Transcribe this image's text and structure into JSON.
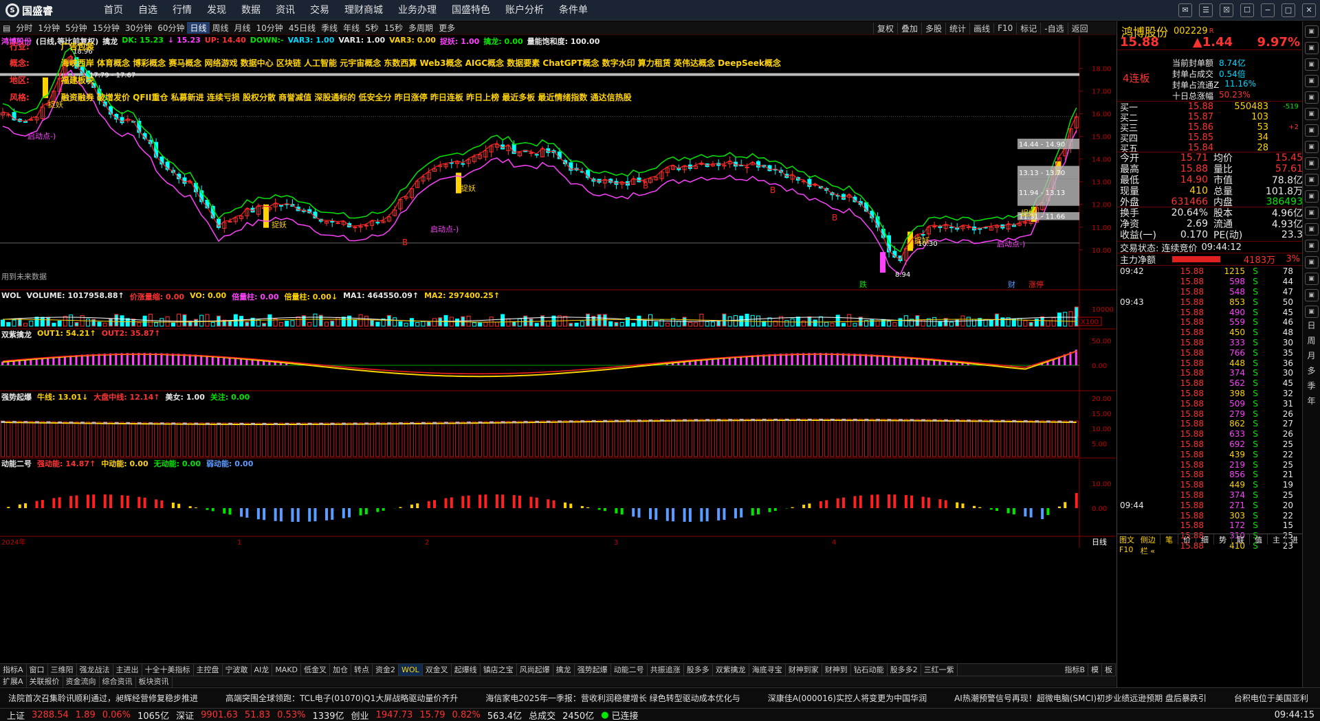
{
  "app": {
    "logo_text": "国盛睿",
    "menu": [
      "首页",
      "自选",
      "行情",
      "发现",
      "数据",
      "资讯",
      "交易",
      "理财商城",
      "业务办理",
      "国盛特色",
      "账户分析",
      "条件单"
    ],
    "win_icons": [
      "✉",
      "☰",
      "☒",
      "☐",
      "−",
      "□",
      "✕"
    ]
  },
  "periods": [
    "分时",
    "1分钟",
    "5分钟",
    "15分钟",
    "30分钟",
    "60分钟",
    "日线",
    "周线",
    "月线",
    "10分钟",
    "45日线",
    "季线",
    "年线",
    "5秒",
    "15秒",
    "多周期",
    "更多"
  ],
  "period_selected": "日线",
  "right_tools": [
    "复权",
    "叠加",
    "多股",
    "统计",
    "画线",
    "F10",
    "标记",
    "-自选",
    "返回"
  ],
  "main_info": {
    "name": "鸿博股份",
    "mode": "(日线,等比前复权)",
    "indicator": "擒龙",
    "items": [
      {
        "t": "DK: 15.23",
        "c": "green"
      },
      {
        "t": "↓ 15.23",
        "c": "mag"
      },
      {
        "t": "UP: 14.40",
        "c": "red"
      },
      {
        "t": "DOWN:-",
        "c": "green"
      },
      {
        "t": "VAR3: 1.00",
        "c": "cyan"
      },
      {
        "t": "VAR1: 1.00",
        "c": "wht"
      },
      {
        "t": "VAR3: 0.00",
        "c": "yel"
      },
      {
        "t": "捉妖: 1.00",
        "c": "mag"
      },
      {
        "t": "擒龙: 0.00",
        "c": "green"
      },
      {
        "t": "量能饱和度: 100.00",
        "c": "wht"
      }
    ]
  },
  "concepts": {
    "industry_label": "行业:",
    "industry": "广告包装",
    "concept_label": "概念:",
    "concept": "海峡西岸 体育概念 博彩概念 赛马概念 网络游戏 数据中心 区块链 人工智能 元宇宙概念 东数西算 Web3概念 AIGC概念 数据要素 ChatGPT概念 数字水印 算力租赁 英伟达概念 DeepSeek概念",
    "region_label": "地区:",
    "region": "福建板块",
    "style_label": "风格:",
    "style": "融资融券 破增发价 QFII重仓 私募新进 连续亏损 股权分散 商誉减值 深股通标的 低安全分 昨日涨停 昨日连板 昨日上榜 最近多板 最近情绪指数 通达信热股"
  },
  "main_y_labels": [
    "18.00",
    "17.00",
    "16.00",
    "15.00",
    "14.00",
    "13.00",
    "12.00",
    "11.00",
    "10.00"
  ],
  "annotations": {
    "high": "18.96",
    "high2": "17.79 - 17.67",
    "low": "8.94",
    "zy": "捉妖",
    "qd": "启动点-)",
    "bb": "B",
    "future": "用到未来数据",
    "r1": "14.44 - 14.90",
    "r2": "13.13 - 13.70",
    "r3": "11.94 - 13.13",
    "r4": "11.31 - 11.66",
    "low2": "10.30",
    "fall": "跌",
    "cai": "财",
    "zt": "涨停"
  },
  "vol_info": {
    "items": [
      {
        "t": "WOL",
        "c": "wht"
      },
      {
        "t": "VOLUME: 1017958.88↑",
        "c": "wht"
      },
      {
        "t": "价涨量缩: 0.00",
        "c": "red"
      },
      {
        "t": "VO: 0.00",
        "c": "yel"
      },
      {
        "t": "倍量柱: 0.00",
        "c": "mag"
      },
      {
        "t": "倍量柱: 0.00↓",
        "c": "yel"
      },
      {
        "t": "MA1: 464550.09↑",
        "c": "wht"
      },
      {
        "t": "MA2: 297400.25↑",
        "c": "yel"
      }
    ],
    "y": [
      "10000"
    ],
    "unit": "X100"
  },
  "sub1_info": {
    "items": [
      {
        "t": "双紫擒龙",
        "c": "wht"
      },
      {
        "t": "OUT1: 54.21↑",
        "c": "yel"
      },
      {
        "t": "OUT2: 35.87↑",
        "c": "red"
      }
    ],
    "y": [
      "50.00",
      "0.00"
    ]
  },
  "sub2_info": {
    "items": [
      {
        "t": "强势起爆",
        "c": "wht"
      },
      {
        "t": "牛线: 13.01↓",
        "c": "yel"
      },
      {
        "t": "大盘中线: 12.14↑",
        "c": "red"
      },
      {
        "t": "美女: 1.00",
        "c": "wht"
      },
      {
        "t": "关注: 0.00",
        "c": "green"
      }
    ],
    "y": [
      "20.00",
      "15.00",
      "10.00",
      "5.00"
    ]
  },
  "sub3_info": {
    "items": [
      {
        "t": "动能二号",
        "c": "wht"
      },
      {
        "t": "强动能: 14.87↑",
        "c": "red"
      },
      {
        "t": "中动能: 0.00",
        "c": "yel"
      },
      {
        "t": "无动能: 0.00",
        "c": "green"
      },
      {
        "t": "弱动能: 0.00",
        "c": "blu"
      }
    ],
    "y": [
      "10.00",
      "0.00"
    ]
  },
  "x_axis": {
    "labels": [
      "2024年",
      "1",
      "2",
      "3",
      "4"
    ],
    "corner": "日线"
  },
  "tabs": [
    "指标A",
    "窗口",
    "三维阳",
    "强龙战法",
    "主进出",
    "十全十美指标",
    "主控盘",
    "宁波敢",
    "AI龙",
    "MAKD",
    "低金叉",
    "加仓",
    "转点",
    "资金2",
    "WOL",
    "双金叉",
    "起爆线",
    "镇店之宝",
    "风尚起爆",
    "擒龙",
    "强势起爆",
    "动能二号",
    "共振追涨",
    "股多多",
    "双紫擒龙",
    "海底寻宝",
    "财神到家",
    "财神到",
    "钻石动能",
    "股多多2",
    "三红一紫"
  ],
  "tab_selected": "WOL",
  "tabs_right": [
    "指标B",
    "模",
    "板"
  ],
  "tabs2": [
    "扩展A",
    "关联报价",
    "资金流向",
    "综合资讯",
    "板块资讯"
  ],
  "tabs2_selected": "综合资讯",
  "stock": {
    "name": "鸿博股份",
    "code": "002229",
    "flag": "R",
    "price": "15.88",
    "change": "▲1.44",
    "pct": "9.97%",
    "lianban": "4连板",
    "seal": [
      {
        "k": "当前封单额",
        "v": "8.74亿"
      },
      {
        "k": "封单占成交",
        "v": "0.54倍"
      },
      {
        "k": "封单占流通Z",
        "v": "11.16%"
      },
      {
        "k": "十日总涨幅",
        "v": "50.23%"
      }
    ],
    "buy": [
      {
        "k": "买一",
        "p": "15.88",
        "v": "550483",
        "d": "-519"
      },
      {
        "k": "买二",
        "p": "15.87",
        "v": "103",
        "d": ""
      },
      {
        "k": "买三",
        "p": "15.86",
        "v": "53",
        "d": "+2"
      },
      {
        "k": "买四",
        "p": "15.85",
        "v": "34",
        "d": ""
      },
      {
        "k": "买五",
        "p": "15.84",
        "v": "28",
        "d": ""
      }
    ],
    "stats": [
      {
        "k": "今开",
        "v": "15.71",
        "k2": "均价",
        "v2": "15.45"
      },
      {
        "k": "最高",
        "v": "15.88",
        "k2": "量比",
        "v2": "57.61"
      },
      {
        "k": "最低",
        "v": "14.90",
        "k2": "市值",
        "v2": "78.8亿"
      },
      {
        "k": "现量",
        "v": "410",
        "k2": "总量",
        "v2": "101.8万"
      },
      {
        "k": "外盘",
        "v": "631466",
        "k2": "内盘",
        "v2": "386493"
      }
    ],
    "stats2": [
      {
        "k": "换手",
        "v": "20.64%",
        "k2": "股本",
        "v2": "4.96亿"
      },
      {
        "k": "净资",
        "v": "2.69",
        "k2": "流通",
        "v2": "4.93亿"
      },
      {
        "k": "收益(一)",
        "v": "0.170",
        "k2": "PE(动)",
        "v2": "23.3"
      }
    ],
    "trade_state": "交易状态: 连续竞价",
    "trade_time": "09:44:12",
    "netflow_label": "主力净额",
    "netflow": "4183万",
    "netflow_pct": "3%"
  },
  "ticks": [
    {
      "t": "09:42",
      "p": "15.88",
      "v": "1215",
      "s": "S",
      "n": "78"
    },
    {
      "t": "",
      "p": "15.88",
      "v": "598",
      "s": "S",
      "n": "44"
    },
    {
      "t": "",
      "p": "15.88",
      "v": "548",
      "s": "S",
      "n": "47"
    },
    {
      "t": "09:43",
      "p": "15.88",
      "v": "853",
      "s": "S",
      "n": "50"
    },
    {
      "t": "",
      "p": "15.88",
      "v": "490",
      "s": "S",
      "n": "45"
    },
    {
      "t": "",
      "p": "15.88",
      "v": "559",
      "s": "S",
      "n": "46"
    },
    {
      "t": "",
      "p": "15.88",
      "v": "450",
      "s": "S",
      "n": "48"
    },
    {
      "t": "",
      "p": "15.88",
      "v": "333",
      "s": "S",
      "n": "30"
    },
    {
      "t": "",
      "p": "15.88",
      "v": "766",
      "s": "S",
      "n": "35"
    },
    {
      "t": "",
      "p": "15.88",
      "v": "448",
      "s": "S",
      "n": "36"
    },
    {
      "t": "",
      "p": "15.88",
      "v": "374",
      "s": "S",
      "n": "30"
    },
    {
      "t": "",
      "p": "15.88",
      "v": "562",
      "s": "S",
      "n": "45"
    },
    {
      "t": "",
      "p": "15.88",
      "v": "398",
      "s": "S",
      "n": "32"
    },
    {
      "t": "",
      "p": "15.88",
      "v": "509",
      "s": "S",
      "n": "31"
    },
    {
      "t": "",
      "p": "15.88",
      "v": "279",
      "s": "S",
      "n": "26"
    },
    {
      "t": "",
      "p": "15.88",
      "v": "862",
      "s": "S",
      "n": "27"
    },
    {
      "t": "",
      "p": "15.88",
      "v": "633",
      "s": "S",
      "n": "26"
    },
    {
      "t": "",
      "p": "15.88",
      "v": "692",
      "s": "S",
      "n": "25"
    },
    {
      "t": "",
      "p": "15.88",
      "v": "439",
      "s": "S",
      "n": "22"
    },
    {
      "t": "",
      "p": "15.88",
      "v": "219",
      "s": "S",
      "n": "25"
    },
    {
      "t": "",
      "p": "15.88",
      "v": "856",
      "s": "S",
      "n": "21"
    },
    {
      "t": "",
      "p": "15.88",
      "v": "449",
      "s": "S",
      "n": "19"
    },
    {
      "t": "",
      "p": "15.88",
      "v": "374",
      "s": "S",
      "n": "25"
    },
    {
      "t": "09:44",
      "p": "15.88",
      "v": "271",
      "s": "S",
      "n": "20"
    },
    {
      "t": "",
      "p": "15.88",
      "v": "303",
      "s": "S",
      "n": "22"
    },
    {
      "t": "",
      "p": "15.88",
      "v": "172",
      "s": "S",
      "n": "15"
    },
    {
      "t": "",
      "p": "15.88",
      "v": "310",
      "s": "S",
      "n": "25"
    },
    {
      "t": "",
      "p": "15.88",
      "v": "410",
      "s": "S",
      "n": "23"
    }
  ],
  "panel_bottom": {
    "left": [
      "图文F10",
      "侧边栏 «"
    ],
    "tabs": [
      "笔",
      "价",
      "细",
      "势",
      "联",
      "值",
      "主",
      "进"
    ]
  },
  "sidebar_vtext": [
    "日",
    "周",
    "月",
    "多",
    "季",
    "年"
  ],
  "news": [
    "法院首次召集聆讯顺利通过，昶辉经营修复稳步推进",
    "高端突围全球领跑：TCL电子(01070)Q1大屏战略驱动量价齐升",
    "海信家电2025年一季报：营收利润稳健增长  绿色转型驱动成本优化与",
    "深康佳A(000016)实控人将变更为中国华润",
    "AI热潮预警信号再现！超微电脑(SMCI)初步业绩远逊预期  盘后暴跌引",
    "台积电位于美国亚利"
  ],
  "status": {
    "sh_label": "上证",
    "sh": "3288.54",
    "sh_chg": "1.89",
    "sh_pct": "0.06%",
    "sh_amt": "1065亿",
    "sz_label": "深证",
    "sz": "9901.63",
    "sz_chg": "51.83",
    "sz_pct": "0.53%",
    "sz_amt": "1339亿",
    "cy_label": "创业",
    "cy": "1947.73",
    "cy_chg": "15.79",
    "cy_pct": "0.82%",
    "cy_amt": "563.4亿",
    "total_label": "总成交",
    "total": "2450亿",
    "conn": "已连接",
    "time": "09:44:15"
  }
}
